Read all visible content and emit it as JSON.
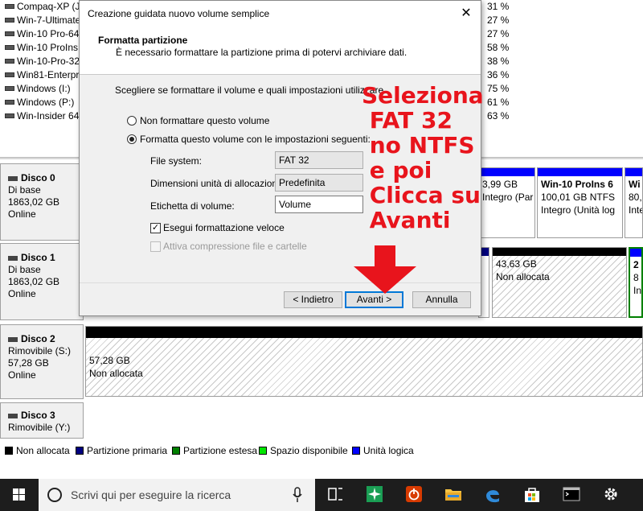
{
  "volumes": [
    {
      "name": "Compaq-XP (J:)",
      "pct": "31 %"
    },
    {
      "name": "Win-7-Ultimate",
      "pct": "27 %"
    },
    {
      "name": "Win-10 Pro-64",
      "pct": "27 %"
    },
    {
      "name": "Win-10 ProIns",
      "pct": "58 %"
    },
    {
      "name": "Win-10-Pro-32",
      "pct": "38 %"
    },
    {
      "name": "Win81-Enterprise",
      "pct": "36 %"
    },
    {
      "name": "Windows (I:)",
      "pct": "75 %"
    },
    {
      "name": "Windows (P:)",
      "pct": "61 %"
    },
    {
      "name": "Win-Insider 64",
      "pct": "63 %"
    }
  ],
  "disks": [
    {
      "name": "Disco 0",
      "type": "Di base",
      "size": "1863,02 GB",
      "status": "Online"
    },
    {
      "name": "Disco 1",
      "type": "Di base",
      "size": "1863,02 GB",
      "status": "Online"
    },
    {
      "name": "Disco 2",
      "type": "Rimovibile (S:)",
      "size": "57,28 GB",
      "status": "Online"
    },
    {
      "name": "Disco 3",
      "type": "Rimovibile (Y:)"
    }
  ],
  "partitions": {
    "d0_p1": {
      "size": "3,99 GB",
      "status": "Integro (Par"
    },
    "d0_p2": {
      "title": "Win-10 ProIns 6",
      "size": "100,01 GB NTFS",
      "status": "Integro (Unità log"
    },
    "d0_p3": {
      "title": "Wi",
      "size": "80,",
      "status": "Inte"
    },
    "d1_p1": {
      "size": "43,63 GB",
      "status": "Non allocata"
    },
    "d1_p2": {
      "title": "2",
      "size": "8",
      "status": "In"
    },
    "d2_p1": {
      "size": "57,28 GB",
      "status": "Non allocata"
    }
  },
  "legend": [
    {
      "label": "Non allocata",
      "color": "#000000"
    },
    {
      "label": "Partizione primaria",
      "color": "#000080"
    },
    {
      "label": "Partizione estesa",
      "color": "#008000"
    },
    {
      "label": "Spazio disponibile",
      "color": "#00e600"
    },
    {
      "label": "Unità logica",
      "color": "#0000ff"
    }
  ],
  "taskbar": {
    "search_placeholder": "Scrivi qui per eseguire la ricerca",
    "apps": [
      "task-view",
      "ccleaner",
      "power-app",
      "file-explorer",
      "edge",
      "store",
      "terminal",
      "settings"
    ]
  },
  "dialog": {
    "title": "Creazione guidata nuovo volume semplice",
    "heading": "Formatta partizione",
    "subheading": "È necessario formattare la partizione prima di potervi archiviare dati.",
    "instruction": "Scegliere se formattare il volume e quali impostazioni utilizzare.",
    "option_no_format": "Non formattare questo volume",
    "option_format": "Formatta questo volume con le impostazioni seguenti:",
    "selected_option": "format",
    "file_system_label": "File system:",
    "file_system_value": "FAT 32",
    "alloc_label": "Dimensioni unità di allocazione:",
    "alloc_value": "Predefinita",
    "volume_label_label": "Etichetta di volume:",
    "volume_label_value": "Volume",
    "quick_format_label": "Esegui formattazione veloce",
    "quick_format_checked": true,
    "compression_label": "Attiva compressione file e cartelle",
    "compression_checked": false,
    "back_button": "< Indietro",
    "next_button": "Avanti >",
    "cancel_button": "Annulla",
    "close_glyph": "✕"
  },
  "annotation": {
    "lines": [
      "Seleziona",
      " FAT 32",
      " no NTFS",
      " e poi",
      " Clicca su",
      " Avanti"
    ],
    "color": "#e8141c"
  }
}
